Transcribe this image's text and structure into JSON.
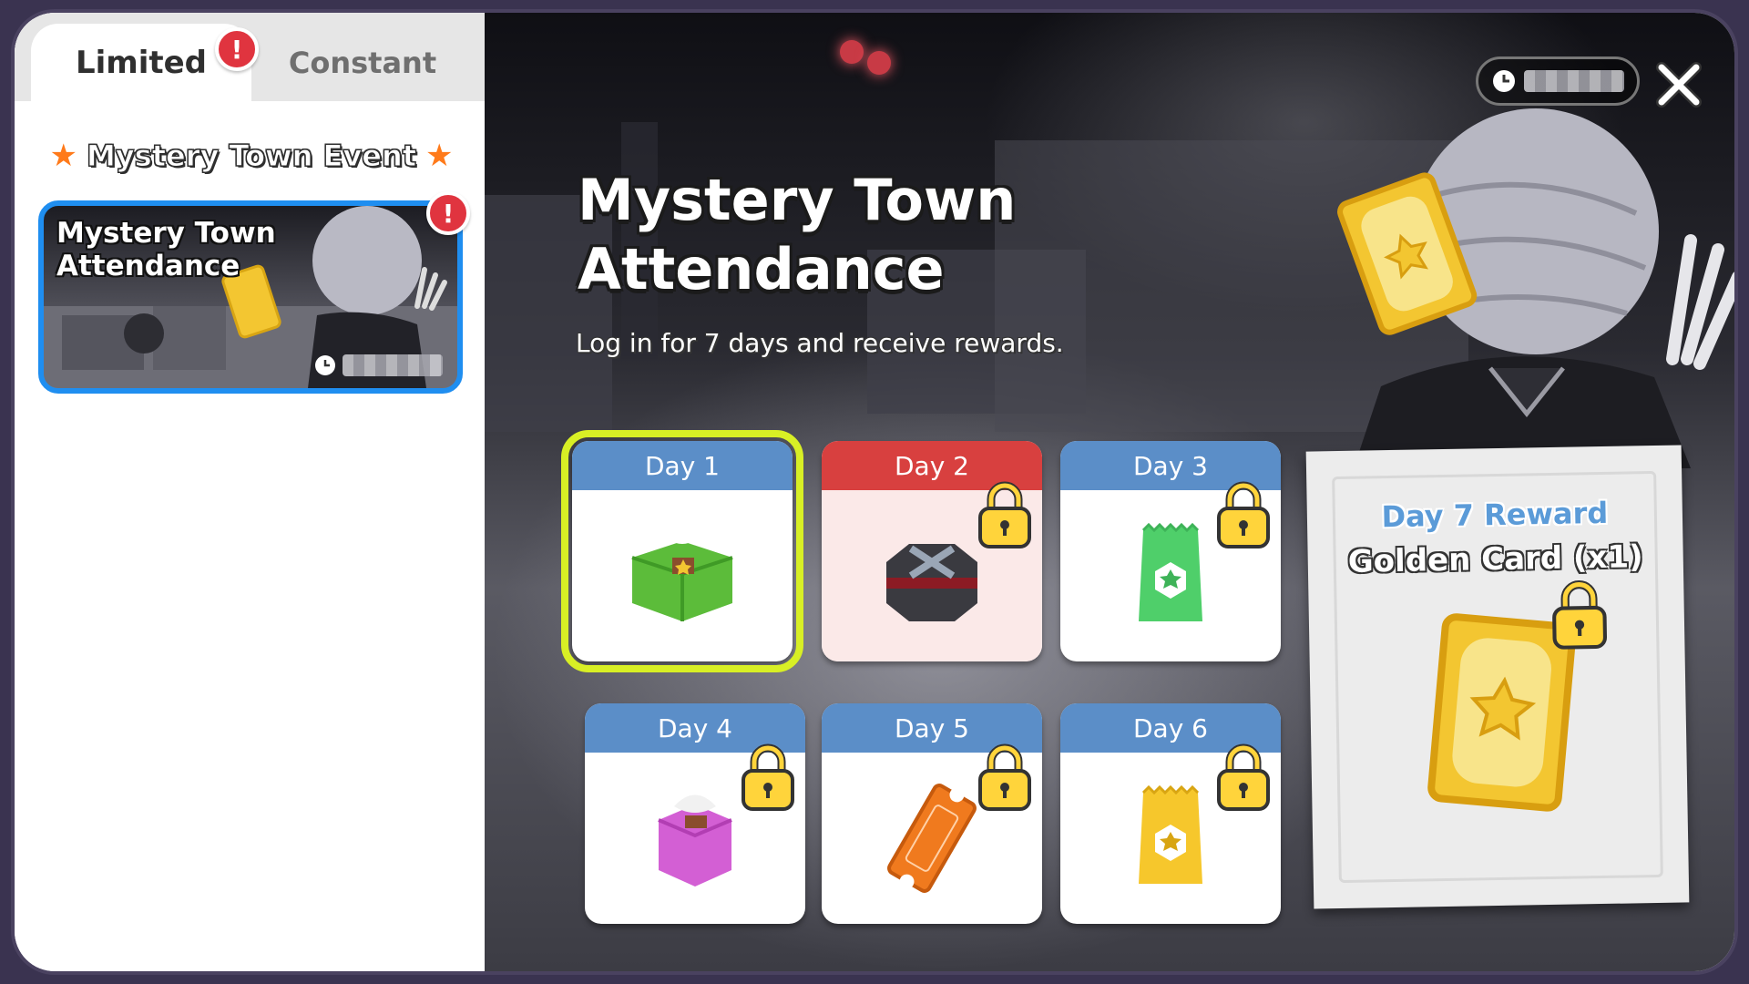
{
  "tabs": {
    "limited": "Limited",
    "constant": "Constant",
    "limited_alert": "!"
  },
  "sidebar": {
    "section_title": "Mystery Town Event",
    "event_card": {
      "title_line1": "Mystery Town",
      "title_line2": "Attendance",
      "alert": "!"
    }
  },
  "event": {
    "title_line1": "Mystery Town",
    "title_line2": "Attendance",
    "subtitle": "Log in for 7 days and receive rewards.",
    "close_label": "✕"
  },
  "days": [
    {
      "label": "Day 1",
      "item_icon": "green-gift-box-icon",
      "locked": false,
      "active": true
    },
    {
      "label": "Day 2",
      "item_icon": "black-hat-box-icon",
      "locked": true,
      "active": false
    },
    {
      "label": "Day 3",
      "item_icon": "green-pack-icon",
      "locked": true,
      "active": false
    },
    {
      "label": "Day 4",
      "item_icon": "pink-gift-box-icon",
      "locked": true,
      "active": false
    },
    {
      "label": "Day 5",
      "item_icon": "coupon-ticket-icon",
      "locked": true,
      "active": false
    },
    {
      "label": "Day 6",
      "item_icon": "yellow-pack-icon",
      "locked": true,
      "active": false
    }
  ],
  "day7": {
    "label": "Day 7 Reward",
    "reward_name": "Golden Card (x1)",
    "item_icon": "golden-card-icon"
  },
  "colors": {
    "accent_blue": "#1f8ef0",
    "day_header": "#5b8ec8",
    "day2_header": "#d8403f",
    "active_outline": "#d8ef25",
    "alert": "#e0343f"
  }
}
